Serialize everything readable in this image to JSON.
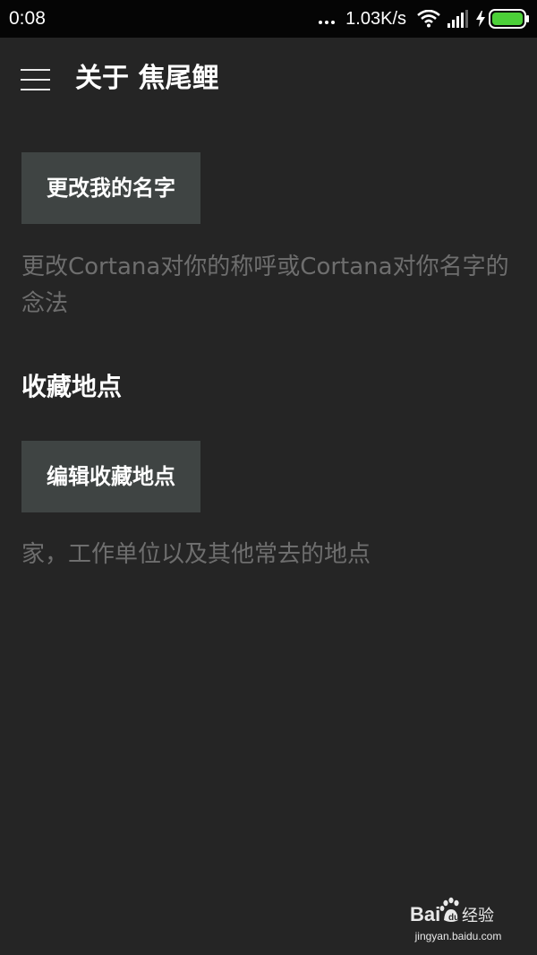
{
  "status_bar": {
    "time": "0:08",
    "net_speed": "1.03K/s",
    "icons": [
      "dots-icon",
      "wifi-icon",
      "signal-icon",
      "charging-icon",
      "battery-icon"
    ],
    "battery_color": "#4cd038"
  },
  "app_bar": {
    "menu_icon": "hamburger-menu-icon",
    "title": "关于 焦尾鲤"
  },
  "name_section": {
    "button_label": "更改我的名字",
    "description": "更改Cortana对你的称呼或Cortana对你名字的念法"
  },
  "places_section": {
    "header": "收藏地点",
    "button_label": "编辑收藏地点",
    "description": "家，工作单位以及其他常去的地点"
  },
  "watermark": {
    "logo_text": "Bai经验",
    "url": "jingyan.baidu.com"
  },
  "colors": {
    "background": "#252525",
    "status_bar": "#050505",
    "button": "#3f4443",
    "description_text": "#6e6e6e"
  }
}
